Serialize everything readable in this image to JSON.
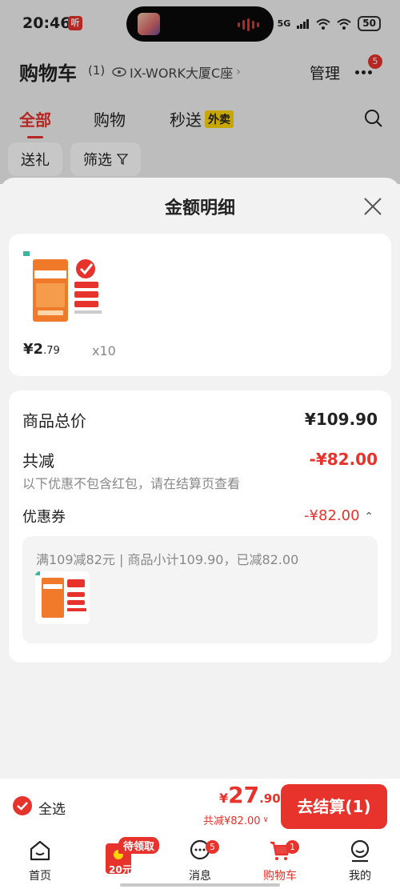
{
  "status_bar": {
    "time": "20:46",
    "app_icon_text": "听",
    "network": "5G",
    "battery": "50"
  },
  "header": {
    "title": "购物车",
    "count": "(1)",
    "address": "IX-WORK大厦C座",
    "manage_label": "管理",
    "more_badge": "5"
  },
  "tabs": [
    {
      "label": "全部",
      "active": true
    },
    {
      "label": "购物",
      "active": false
    },
    {
      "label": "秒送",
      "active": false,
      "tag": "外卖"
    }
  ],
  "filters": {
    "gift_label": "送礼",
    "filter_label": "筛选"
  },
  "sheet": {
    "title": "金额明细",
    "product": {
      "price_main": "¥2",
      "price_decimal": ".79",
      "quantity": "x10"
    },
    "breakdown": {
      "total_label": "商品总价",
      "total_value": "¥109.90",
      "reduce_label": "共减",
      "reduce_value": "-¥82.00",
      "reduce_note": "以下优惠不包含红包，请在结算页查看",
      "coupon_label": "优惠券",
      "coupon_value": "-¥82.00",
      "coupon_desc": "满109减82元 | 商品小计109.90，已减82.00"
    }
  },
  "checkout": {
    "select_all_label": "全选",
    "currency": "¥",
    "total_main": "27",
    "total_decimal": ".90",
    "discount_text": "共减¥82.00",
    "button_label": "去结算(1)"
  },
  "nav": {
    "home_label": "首页",
    "promo_tag": "待领取",
    "promo_amount": "20元",
    "messages_label": "消息",
    "messages_badge": "5",
    "cart_label": "购物车",
    "cart_badge": "1",
    "me_label": "我的"
  },
  "colors": {
    "accent": "#e8322c",
    "tag_yellow": "#ffd600"
  }
}
